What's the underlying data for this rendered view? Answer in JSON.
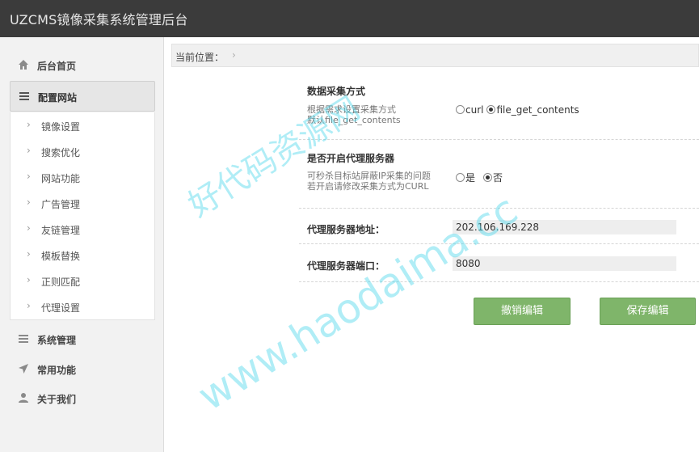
{
  "app": {
    "title": "UZCMS镜像采集系统管理后台"
  },
  "sidebar": {
    "items": [
      {
        "label": "后台首页",
        "icon": "home-icon"
      },
      {
        "label": "配置网站",
        "icon": "list-icon"
      },
      {
        "label": "系统管理",
        "icon": "list-icon"
      },
      {
        "label": "常用功能",
        "icon": "send-icon"
      },
      {
        "label": "关于我们",
        "icon": "user-icon"
      }
    ],
    "submenu": [
      {
        "label": "镜像设置"
      },
      {
        "label": "搜索优化"
      },
      {
        "label": "网站功能"
      },
      {
        "label": "广告管理"
      },
      {
        "label": "友链管理"
      },
      {
        "label": "模板替换"
      },
      {
        "label": "正则匹配"
      },
      {
        "label": "代理设置"
      }
    ]
  },
  "breadcrumb": {
    "label": "当前位置："
  },
  "form": {
    "collect": {
      "title": "数据采集方式",
      "help1": "根据需求设置采集方式",
      "help2": "默认file_get_contents",
      "opt1": "curl",
      "opt2": "file_get_contents",
      "selected": "file_get_contents"
    },
    "proxy": {
      "title": "是否开启代理服务器",
      "help1": "可秒杀目标站屏蔽IP采集的问题",
      "help2": "若开启请修改采集方式为CURL",
      "opt1": "是",
      "opt2": "否",
      "selected": "否"
    },
    "address": {
      "label": "代理服务器地址：",
      "value": "202.106.169.228"
    },
    "port": {
      "label": "代理服务器端口：",
      "value": "8080"
    }
  },
  "buttons": {
    "cancel": "撤销编辑",
    "save": "保存编辑"
  },
  "watermark": {
    "line1": "好代码资源网",
    "line2": "www.haodaima.cc"
  },
  "colors": {
    "topbar": "#3b3b3b",
    "button": "#7fb56a",
    "sidebar": "#f2f2f2"
  }
}
